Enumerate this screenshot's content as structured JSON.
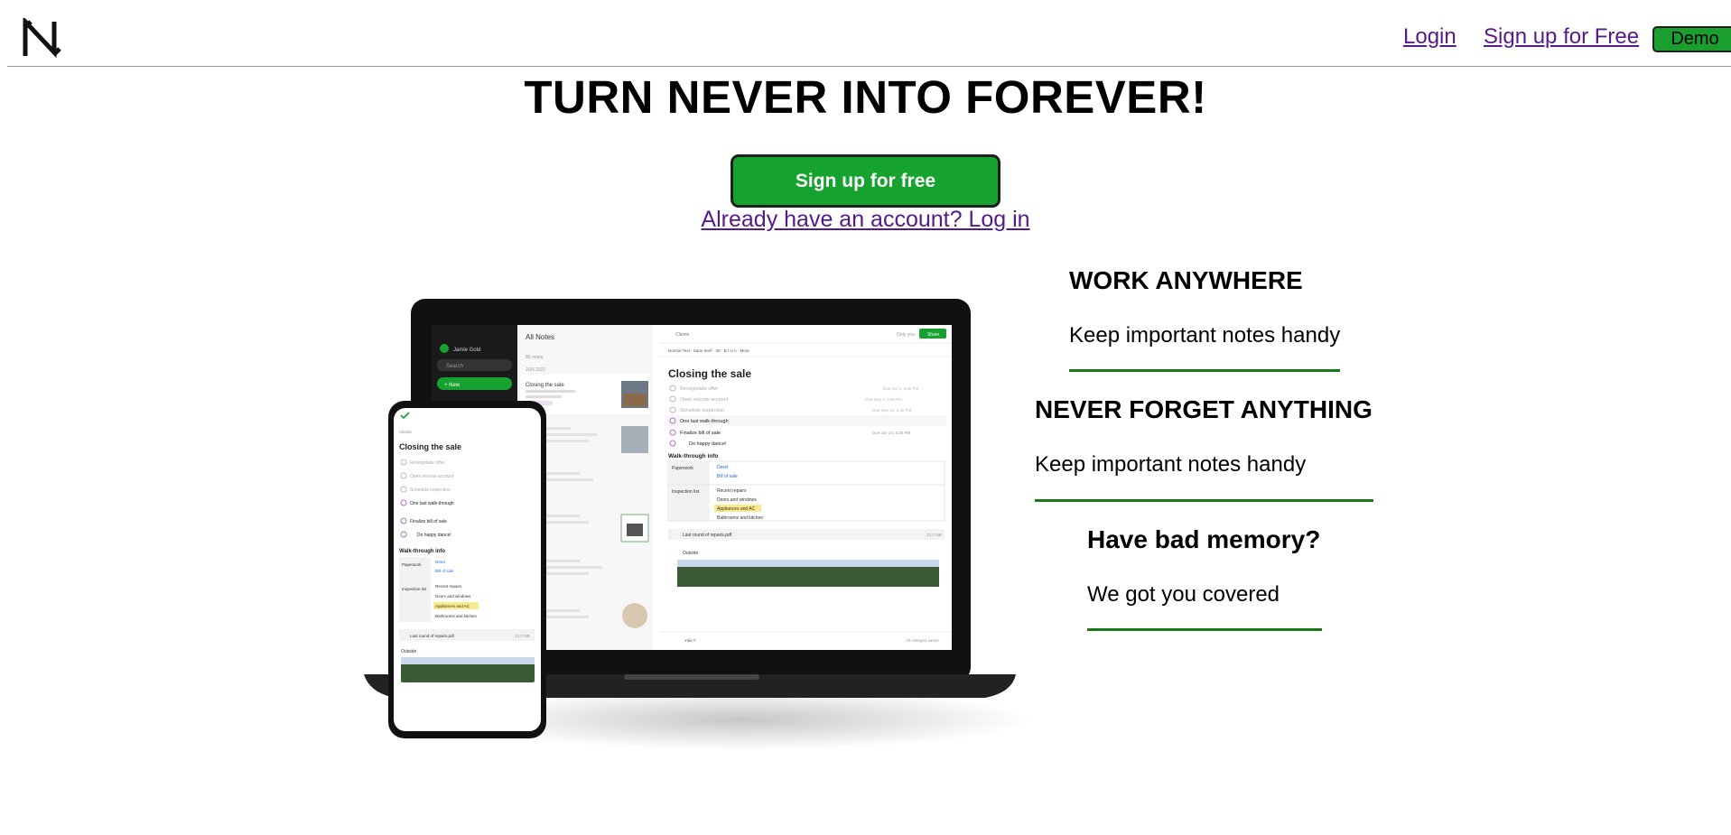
{
  "header": {
    "logo_name": "n-logo-icon",
    "nav_login": "Login",
    "nav_signup": "Sign up for Free",
    "demo_label": "Demo"
  },
  "hero": {
    "headline": "TURN NEVER INTO FOREVER!",
    "cta_label": "Sign up for free",
    "login_link": "Already have an account? Log in"
  },
  "mock": {
    "sidebar_user": "Jamie Gold",
    "sidebar_search": "Search",
    "sidebar_new": "+ New",
    "list_title": "All Notes",
    "list_count": "86 notes",
    "list_month": "JUN 2021",
    "list_first_title": "Closing the sale",
    "note_breadcrumb": "Clients",
    "note_only_you": "Only you",
    "note_share": "Share",
    "note_toolbar": "Normal Text  ·  Sans Serif  ·  30  ·  B  I  U  A  ·  More",
    "note_title": "Closing the sale",
    "tasks": [
      {
        "text": "Renegotiate offer",
        "due": "Due Apr 3, 5:30 PM",
        "done": true
      },
      {
        "text": "Open escrow account",
        "due": "Due May 4, 6:30 PM",
        "done": true
      },
      {
        "text": "Schedule inspection",
        "due": "Due May 21, 2:30 PM",
        "done": true
      },
      {
        "text": "One last walk-through",
        "due": "",
        "done": false
      },
      {
        "text": "Finalize bill of sale",
        "due": "Due Jun 24, 5:30 PM",
        "done": false
      },
      {
        "text": "Do happy dance!",
        "due": "",
        "done": false
      }
    ],
    "section_title": "Walk-through info",
    "paperwork_label": "Paperwork",
    "paperwork_items": [
      "Deed",
      "Bill of sale"
    ],
    "inspection_label": "Inspection list",
    "inspection_items": [
      "Recent repairs",
      "Doors and windows",
      "Appliances and AC",
      "Bathrooms and kitchen"
    ],
    "attachment_name": "Last round of repairs.pdf",
    "attachment_size": "13.2 MB",
    "outside_label": "Outside",
    "footer_tag": "Yuki T.",
    "footer_saved": "All changes saved"
  },
  "features": [
    {
      "title": "WORK ANYWHERE",
      "text": "Keep important notes handy"
    },
    {
      "title": "NEVER FORGET ANYTHING",
      "text": "Keep important notes handy"
    },
    {
      "title": "Have bad memory?",
      "text": "We got you covered"
    }
  ],
  "colors": {
    "brand_green": "#15a22e",
    "rule_green": "#1a7a1a",
    "link_purple": "#551a8b"
  }
}
